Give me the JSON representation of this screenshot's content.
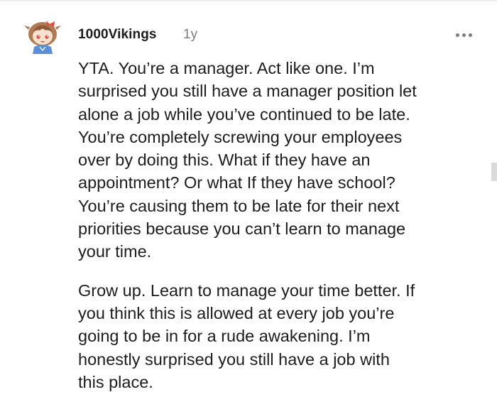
{
  "comment": {
    "username": "1000Vikings",
    "age": "1y",
    "more_icon": "more-horizontal-icon",
    "paragraphs": [
      "YTA. You’re a manager. Act like one. I’m\nsurprised you still have a manager position let\nalone a job while you’ve continued to be late.\nYou’re completely screwing your employees\nover by doing this. What if they have an\nappointment? Or what If they have school?\nYou’re causing them to be late for their next\npriorities because you can’t learn to manage\nyour time.",
      "Grow up. Learn to manage your time better. If\nyou think this is allowed at every job you’re\ngoing to be in for a rude awakening. I’m\nhonestly surprised you still have a job with\nthis place."
    ]
  },
  "colors": {
    "text": "#1c1c1c",
    "meta": "#7c7c7c",
    "avatar_hair": "#b07a55",
    "avatar_bow": "#e8463a",
    "avatar_shirt": "#5a8fd8"
  }
}
